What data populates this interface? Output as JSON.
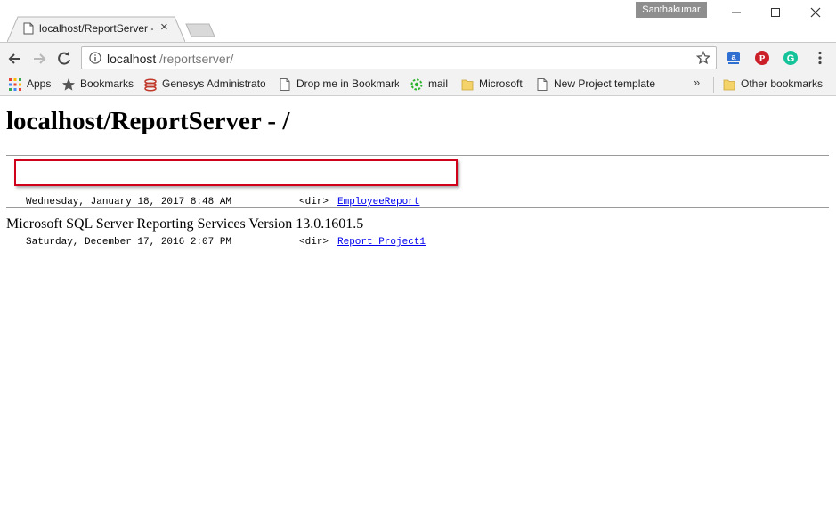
{
  "window": {
    "profile_name": "Santhakumar",
    "minimize_glyph": "—",
    "maximize_glyph": "☐",
    "close_glyph": "✕"
  },
  "tab": {
    "title": "localhost/ReportServer - /",
    "close_glyph": "×",
    "icon": "page-icon"
  },
  "toolbar": {
    "url_host": "localhost",
    "url_path": "/reportserver/",
    "icons": [
      "back-arrow-icon",
      "forward-arrow-icon",
      "reload-icon",
      "info-icon",
      "star-icon",
      "extension-a-icon",
      "pinterest-icon",
      "grammarly-icon",
      "menu-dots-icon"
    ]
  },
  "bookmarks": {
    "items": [
      {
        "label": "Apps",
        "icon": "apps-grid-icon"
      },
      {
        "label": "Bookmarks",
        "icon": "star-icon"
      },
      {
        "label": "Genesys Administrato",
        "icon": "genesys-icon"
      },
      {
        "label": "Drop me in Bookmark",
        "icon": "page-icon"
      },
      {
        "label": "mail",
        "icon": "mail-icon"
      },
      {
        "label": "Microsoft",
        "icon": "folder-icon"
      },
      {
        "label": "New Project template",
        "icon": "page-icon"
      }
    ],
    "overflow_glyph": "»",
    "other_label": "Other bookmarks"
  },
  "page": {
    "heading": "localhost/ReportServer - /",
    "entries": [
      {
        "date": "Wednesday, January 18, 2017 8:48 AM",
        "type": "<dir>",
        "name": "EmployeeReport"
      },
      {
        "date": "Saturday, December 17, 2016 2:07 PM",
        "type": "<dir>",
        "name": "Report Project1"
      }
    ],
    "footer": "Microsoft SQL Server Reporting Services Version 13.0.1601.5"
  },
  "colors": {
    "highlight_border": "#d0021b",
    "link": "#0000ee",
    "chrome_bg": "#f2f2f2"
  }
}
